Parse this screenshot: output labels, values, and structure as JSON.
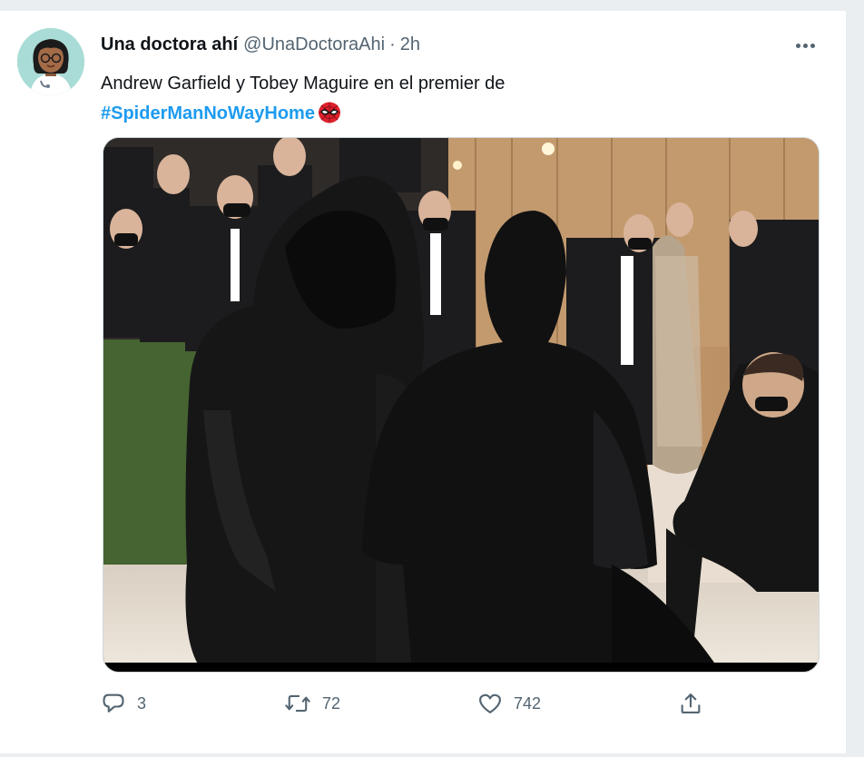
{
  "tweet": {
    "author_name": "Una doctora ahí",
    "author_handle": "@UnaDoctoraAhi",
    "separator": "·",
    "time": "2h",
    "text_line1": "Andrew Garfield y Tobey Maguire en el premier de",
    "hashtag": "#SpiderManNoWayHome",
    "emoji_icon": "spider-man-mask-icon"
  },
  "actions": {
    "reply_count": "3",
    "retweet_count": "72",
    "like_count": "742"
  },
  "colors": {
    "link": "#1d9bf0",
    "text": "#0f1419",
    "secondary": "#536471",
    "background": "#ebeef0"
  },
  "icons": [
    "reply-icon",
    "retweet-icon",
    "like-icon",
    "share-icon",
    "more-icon"
  ]
}
